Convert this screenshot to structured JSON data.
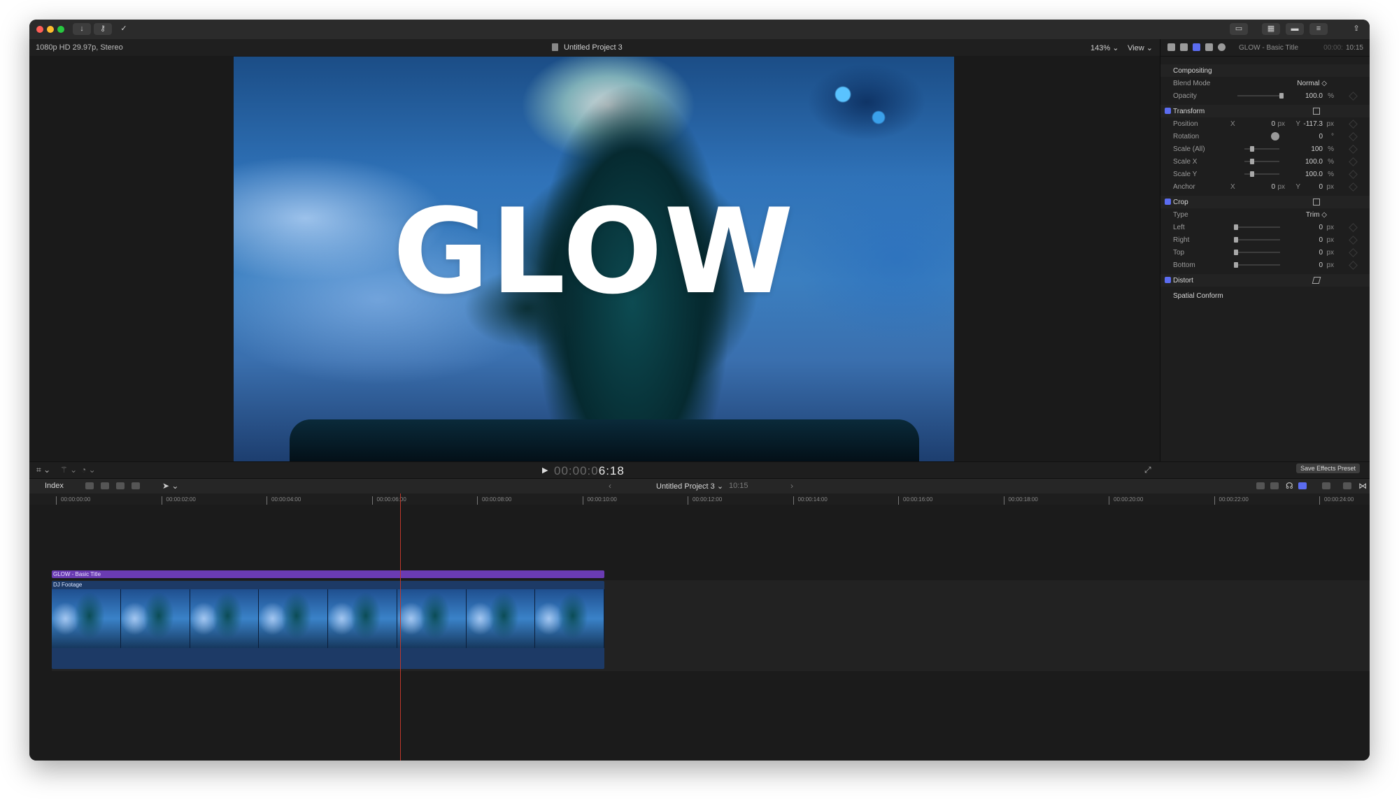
{
  "viewer": {
    "format": "1080p HD 29.97p, Stereo",
    "project_title": "Untitled Project 3",
    "zoom": "143%",
    "view_menu": "View",
    "title_text": "GLOW"
  },
  "transport": {
    "timecode_dim": "00:00:0",
    "timecode_bright": "6:18"
  },
  "inspector": {
    "clip_title": "GLOW - Basic Title",
    "duration_dim": "00:00:",
    "duration": "10:15",
    "sections": {
      "compositing": "Compositing",
      "transform": "Transform",
      "crop": "Crop",
      "distort": "Distort",
      "spatial_conform": "Spatial Conform"
    },
    "params": {
      "blend_mode_label": "Blend Mode",
      "blend_mode_value": "Normal ◇",
      "opacity_label": "Opacity",
      "opacity_value": "100.0",
      "opacity_unit": "%",
      "opacity_fraction": 1.0,
      "position_label": "Position",
      "position_x_label": "X",
      "position_x": "0",
      "position_x_unit": "px",
      "position_y_label": "Y",
      "position_y": "-117.3",
      "position_y_unit": "px",
      "rotation_label": "Rotation",
      "rotation_value": "0",
      "rotation_unit": "°",
      "scale_all_label": "Scale (All)",
      "scale_all_value": "100",
      "scale_all_unit": "%",
      "scale_x_label": "Scale X",
      "scale_x_value": "100.0",
      "scale_x_unit": "%",
      "scale_y_label": "Scale Y",
      "scale_y_value": "100.0",
      "scale_y_unit": "%",
      "anchor_label": "Anchor",
      "anchor_x_label": "X",
      "anchor_x": "0",
      "anchor_x_unit": "px",
      "anchor_y_label": "Y",
      "anchor_y": "0",
      "anchor_y_unit": "px",
      "crop_type_label": "Type",
      "crop_type_value": "Trim ◇",
      "crop_left_label": "Left",
      "crop_left": "0",
      "crop_right_label": "Right",
      "crop_right": "0",
      "crop_top_label": "Top",
      "crop_top": "0",
      "crop_bottom_label": "Bottom",
      "crop_bottom": "0",
      "px": "px"
    },
    "save_preset": "Save Effects Preset"
  },
  "timeline": {
    "index_label": "Index",
    "project_title": "Untitled Project 3",
    "duration": "10:15",
    "ruler": [
      "00:00:00:00",
      "00:00:02:00",
      "00:00:04:00",
      "00:00:06:00",
      "00:00:08:00",
      "00:00:10:00",
      "00:00:12:00",
      "00:00:14:00",
      "00:00:16:00",
      "00:00:18:00",
      "00:00:20:00",
      "00:00:22:00",
      "00:00:24:00"
    ],
    "title_clip": "GLOW - Basic Title",
    "video_clip": "DJ Footage"
  },
  "colors": {
    "title_clip": "#6a3bb2",
    "video_clip": "#1d3a66",
    "playhead": "#c0392b",
    "accent": "#5b6cf0"
  }
}
